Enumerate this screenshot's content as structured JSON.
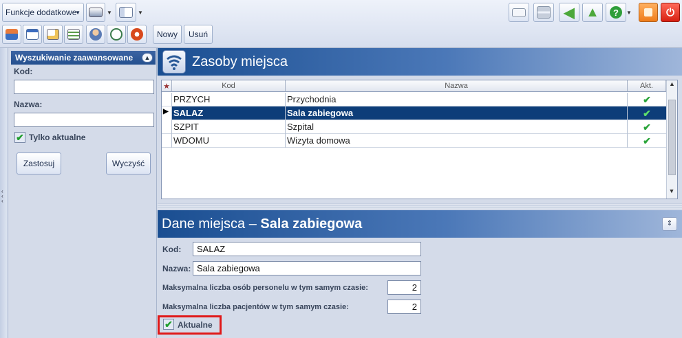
{
  "toolbar": {
    "funkcje_label": "Funkcje dodatkowe",
    "nowy_label": "Nowy",
    "usun_label": "Usuń",
    "icons": [
      "home-icon",
      "calendar-icon",
      "edit-icon",
      "list-icon",
      "users-icon",
      "clock-icon",
      "gear-icon"
    ],
    "right_icons": [
      "mail-icon",
      "network-icon",
      "back-arrow-icon",
      "up-arrow-icon",
      "help-icon",
      "lock-icon",
      "power-icon"
    ]
  },
  "search": {
    "title": "Wyszukiwanie zaawansowane",
    "kod_label": "Kod:",
    "kod_value": "",
    "nazwa_label": "Nazwa:",
    "nazwa_value": "",
    "tylko_label": "Tylko aktualne",
    "tylko_checked": true,
    "apply_label": "Zastosuj",
    "clear_label": "Wyczyść"
  },
  "main": {
    "title": "Zasoby miejsca",
    "columns": {
      "star": "★",
      "kod": "Kod",
      "nazwa": "Nazwa",
      "akt": "Akt."
    },
    "rows": [
      {
        "kod": "PRZYCH",
        "nazwa": "Przychodnia",
        "akt": true,
        "selected": false
      },
      {
        "kod": "SALAZ",
        "nazwa": "Sala zabiegowa",
        "akt": true,
        "selected": true
      },
      {
        "kod": "SZPIT",
        "nazwa": "Szpital",
        "akt": true,
        "selected": false
      },
      {
        "kod": "WDOMU",
        "nazwa": "Wizyta domowa",
        "akt": true,
        "selected": false
      }
    ]
  },
  "detail": {
    "title_prefix": "Dane miejsca – ",
    "title_name": "Sala zabiegowa",
    "kod_label": "Kod:",
    "kod_value": "SALAZ",
    "nazwa_label": "Nazwa:",
    "nazwa_value": "Sala zabiegowa",
    "max_personel_label": "Maksymalna liczba osób personelu w tym samym czasie:",
    "max_personel_value": "2",
    "max_pacjenci_label": "Maksymalna liczba pacjentów w tym samym czasie:",
    "max_pacjenci_value": "2",
    "aktualne_label": "Aktualne",
    "aktualne_checked": true
  },
  "colors": {
    "header_blue": "#1a4e91",
    "selection": "#0d3d79",
    "highlight": "#e01818",
    "check": "#2aa43a"
  }
}
